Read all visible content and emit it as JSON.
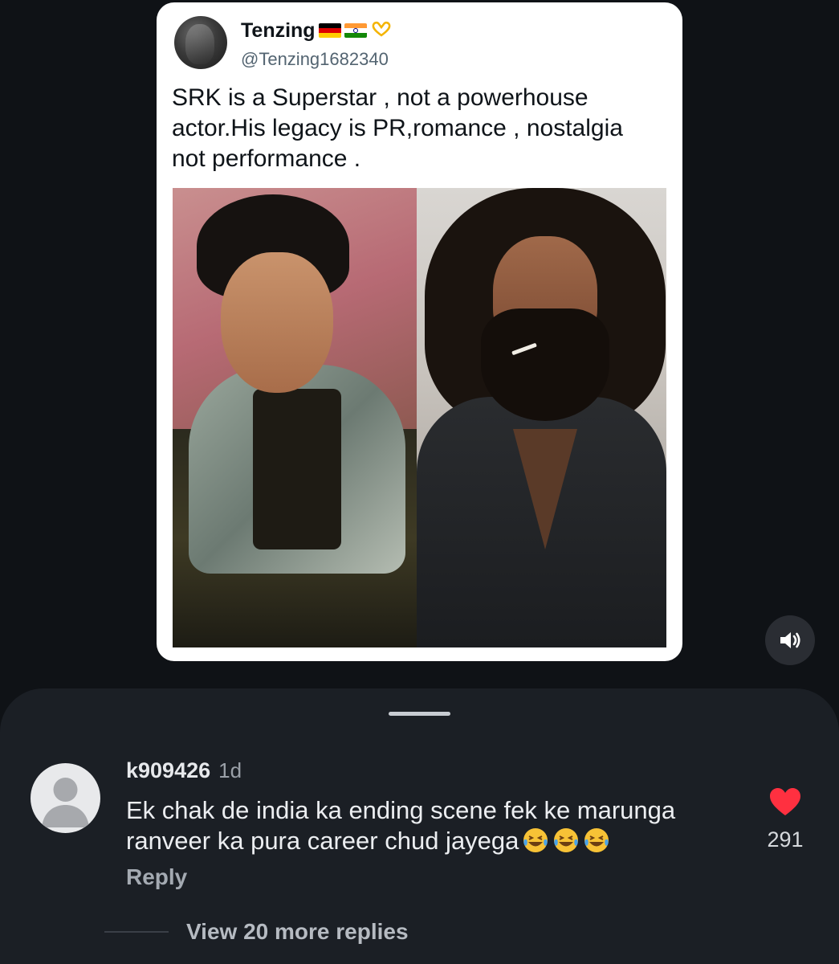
{
  "tweet": {
    "author_name": "Tenzing",
    "author_badges": [
      "german-flag-icon",
      "indian-flag-icon",
      "heart-hands-icon"
    ],
    "handle": "@Tenzing1682340",
    "text_lines": [
      "SRK is a Superstar , not a powerhouse",
      "actor.His legacy is PR,romance , nostalgia",
      "not performance ."
    ],
    "image": {
      "left_photo": "srk-photo",
      "right_photo": "ranveer-photo"
    }
  },
  "media_controls": {
    "sound_icon": "speaker-icon"
  },
  "comments_sheet": {
    "handle_icon": "drag-handle",
    "comment": {
      "username": "k909426",
      "time": "1d",
      "text_lines": [
        "Ek chak de india ka ending scene fek ke marunga",
        "ranveer ka pura career chud jayega"
      ],
      "emoji_count": 3,
      "emoji_icon": "laughing-tears-icon",
      "reply_label": "Reply",
      "like_count": "291",
      "like_icon": "heart-icon",
      "like_color": "#ff3040"
    },
    "view_replies_label": "View 20 more replies"
  },
  "colors": {
    "background": "#0f1216",
    "sheet": "#1b1f25",
    "card": "#ffffff"
  }
}
